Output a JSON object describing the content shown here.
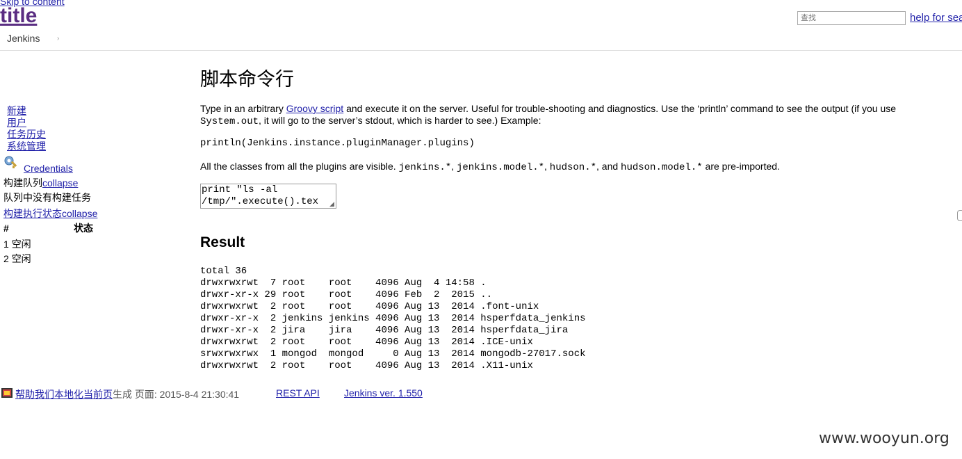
{
  "header": {
    "skip_link": "Skip to content",
    "title": "title",
    "search_placeholder": "查找",
    "help_link": "help for sea",
    "breadcrumb": "Jenkins",
    "breadcrumb_arrow": "›"
  },
  "sidebar": {
    "items": [
      {
        "label": "新建"
      },
      {
        "label": "用户"
      },
      {
        "label": "任务历史"
      },
      {
        "label": "系统管理"
      }
    ],
    "credentials": "Credentials",
    "build_queue_label": "构建队列",
    "build_queue_collapse": "collapse",
    "build_queue_empty": "队列中没有构建任务",
    "executor_label": "构建执行状态",
    "executor_collapse": "collapse",
    "executor_header_num": "#",
    "executor_header_status": "状态",
    "executors": [
      {
        "num": "1",
        "status": "空闲"
      },
      {
        "num": "2",
        "status": "空闲"
      }
    ]
  },
  "main": {
    "page_title": "脚本命令行",
    "intro_before_link": "Type in an arbitrary ",
    "intro_link": "Groovy script",
    "intro_after_link": " and execute it on the server. Useful for trouble-shooting and diagnostics. Use the ‘println’ command to see the output (if you use ",
    "intro_code": "System.out",
    "intro_tail": ", it will go to the server’s stdout, which is harder to see.) Example:",
    "example_code": "println(Jenkins.instance.pluginManager.plugins)",
    "classes_prefix": "All the classes from all the plugins are visible. ",
    "pkg1": "jenkins.*",
    "pkg2": "jenkins.model.*",
    "pkg3": "hudson.*",
    "pkg4": "hudson.model.*",
    "sep1": ", ",
    "sep2": ", ",
    "sep3": ", and ",
    "classes_suffix": " are pre-imported.",
    "script_value": "print \"ls -al\n/tmp/\".execute().tex",
    "result_title": "Result",
    "output": "total 36\ndrwxrwxrwt  7 root    root    4096 Aug  4 14:58 .\ndrwxr-xr-x 29 root    root    4096 Feb  2  2015 ..\ndrwxrwxrwt  2 root    root    4096 Aug 13  2014 .font-unix\ndrwxr-xr-x  2 jenkins jenkins 4096 Aug 13  2014 hsperfdata_jenkins\ndrwxr-xr-x  2 jira    jira    4096 Aug 13  2014 hsperfdata_jira\ndrwxrwxrwt  2 root    root    4096 Aug 13  2014 .ICE-unix\nsrwxrwxrwx  1 mongod  mongod     0 Aug 13  2014 mongodb-27017.sock\ndrwxrwxrwt  2 root    root    4096 Aug 13  2014 .X11-unix"
  },
  "footer": {
    "localize_link": "帮助我们本地化当前页",
    "generated": "生成 页面: 2015-8-4 21:30:41",
    "rest_api": "REST API",
    "version": "Jenkins ver. 1.550"
  },
  "watermark": "www.wooyun.org"
}
